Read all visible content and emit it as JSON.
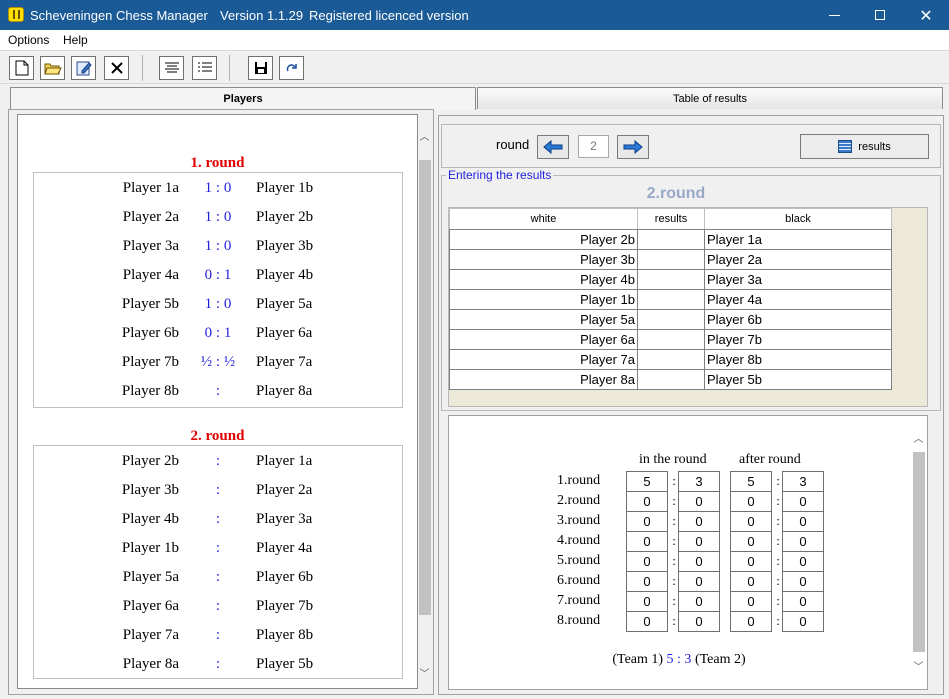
{
  "window": {
    "app_name": "Scheveningen Chess Manager",
    "version": "Version 1.1.29",
    "license": "Registered licenced version",
    "minimize_glyph": "",
    "close_glyph": "✕"
  },
  "menu": {
    "options": "Options",
    "help": "Help"
  },
  "toolbar": {
    "icons": [
      "new-document-icon",
      "open-folder-icon",
      "edit-icon",
      "delete-icon",
      "align-text-icon",
      "list-icon",
      "save-icon",
      "redo-icon"
    ]
  },
  "tabs": {
    "players": "Players",
    "results": "Table of results"
  },
  "left": {
    "rounds": [
      {
        "title": "1. round",
        "pairs": [
          {
            "white": "Player 1a",
            "result": "1 : 0",
            "black": "Player 1b"
          },
          {
            "white": "Player 2a",
            "result": "1 : 0",
            "black": "Player 2b"
          },
          {
            "white": "Player 3a",
            "result": "1 : 0",
            "black": "Player 3b"
          },
          {
            "white": "Player 4a",
            "result": "0 : 1",
            "black": "Player 4b"
          },
          {
            "white": "Player 5b",
            "result": "1 : 0",
            "black": "Player 5a"
          },
          {
            "white": "Player 6b",
            "result": "0 : 1",
            "black": "Player 6a"
          },
          {
            "white": "Player 7b",
            "result": "½ : ½",
            "black": "Player 7a"
          },
          {
            "white": "Player 8b",
            "result": ":",
            "black": "Player 8a"
          }
        ]
      },
      {
        "title": "2. round",
        "pairs": [
          {
            "white": "Player 2b",
            "result": ":",
            "black": "Player 1a"
          },
          {
            "white": "Player 3b",
            "result": ":",
            "black": "Player 2a"
          },
          {
            "white": "Player 4b",
            "result": ":",
            "black": "Player 3a"
          },
          {
            "white": "Player 1b",
            "result": ":",
            "black": "Player 4a"
          },
          {
            "white": "Player 5a",
            "result": ":",
            "black": "Player 6b"
          },
          {
            "white": "Player 6a",
            "result": ":",
            "black": "Player 7b"
          },
          {
            "white": "Player 7a",
            "result": ":",
            "black": "Player 8b"
          },
          {
            "white": "Player 8a",
            "result": ":",
            "black": "Player 5b"
          }
        ]
      }
    ]
  },
  "nav": {
    "round_label": "round",
    "round_value": "2",
    "results_button": "results"
  },
  "entry": {
    "legend": "Entering the results",
    "title": "2.round",
    "columns": {
      "white": "white",
      "results": "results",
      "black": "black"
    },
    "rows": [
      {
        "white": "Player 2b",
        "result": "",
        "black": "Player 1a"
      },
      {
        "white": "Player 3b",
        "result": "",
        "black": "Player 2a"
      },
      {
        "white": "Player 4b",
        "result": "",
        "black": "Player 3a"
      },
      {
        "white": "Player 1b",
        "result": "",
        "black": "Player 4a"
      },
      {
        "white": "Player 5a",
        "result": "",
        "black": "Player 6b"
      },
      {
        "white": "Player 6a",
        "result": "",
        "black": "Player 7b"
      },
      {
        "white": "Player 7a",
        "result": "",
        "black": "Player 8b"
      },
      {
        "white": "Player 8a",
        "result": "",
        "black": "Player 5b"
      }
    ]
  },
  "summary": {
    "in_round_label": "in the round",
    "after_round_label": "after round",
    "rows": [
      {
        "label": "1.round",
        "in_a": "5",
        "in_b": "3",
        "after_a": "5",
        "after_b": "3"
      },
      {
        "label": "2.round",
        "in_a": "0",
        "in_b": "0",
        "after_a": "0",
        "after_b": "0"
      },
      {
        "label": "3.round",
        "in_a": "0",
        "in_b": "0",
        "after_a": "0",
        "after_b": "0"
      },
      {
        "label": "4.round",
        "in_a": "0",
        "in_b": "0",
        "after_a": "0",
        "after_b": "0"
      },
      {
        "label": "5.round",
        "in_a": "0",
        "in_b": "0",
        "after_a": "0",
        "after_b": "0"
      },
      {
        "label": "6.round",
        "in_a": "0",
        "in_b": "0",
        "after_a": "0",
        "after_b": "0"
      },
      {
        "label": "7.round",
        "in_a": "0",
        "in_b": "0",
        "after_a": "0",
        "after_b": "0"
      },
      {
        "label": "8.round",
        "in_a": "0",
        "in_b": "0",
        "after_a": "0",
        "after_b": "0"
      }
    ],
    "colon": ":",
    "team1": "(Team 1)",
    "score": "5 : 3",
    "team2": "(Team 2)"
  },
  "colors": {
    "title_bar": "#1a5a96",
    "round_title": "#e00000",
    "result_blue": "#1f1fe0",
    "entry_title": "#9aa8c8"
  }
}
